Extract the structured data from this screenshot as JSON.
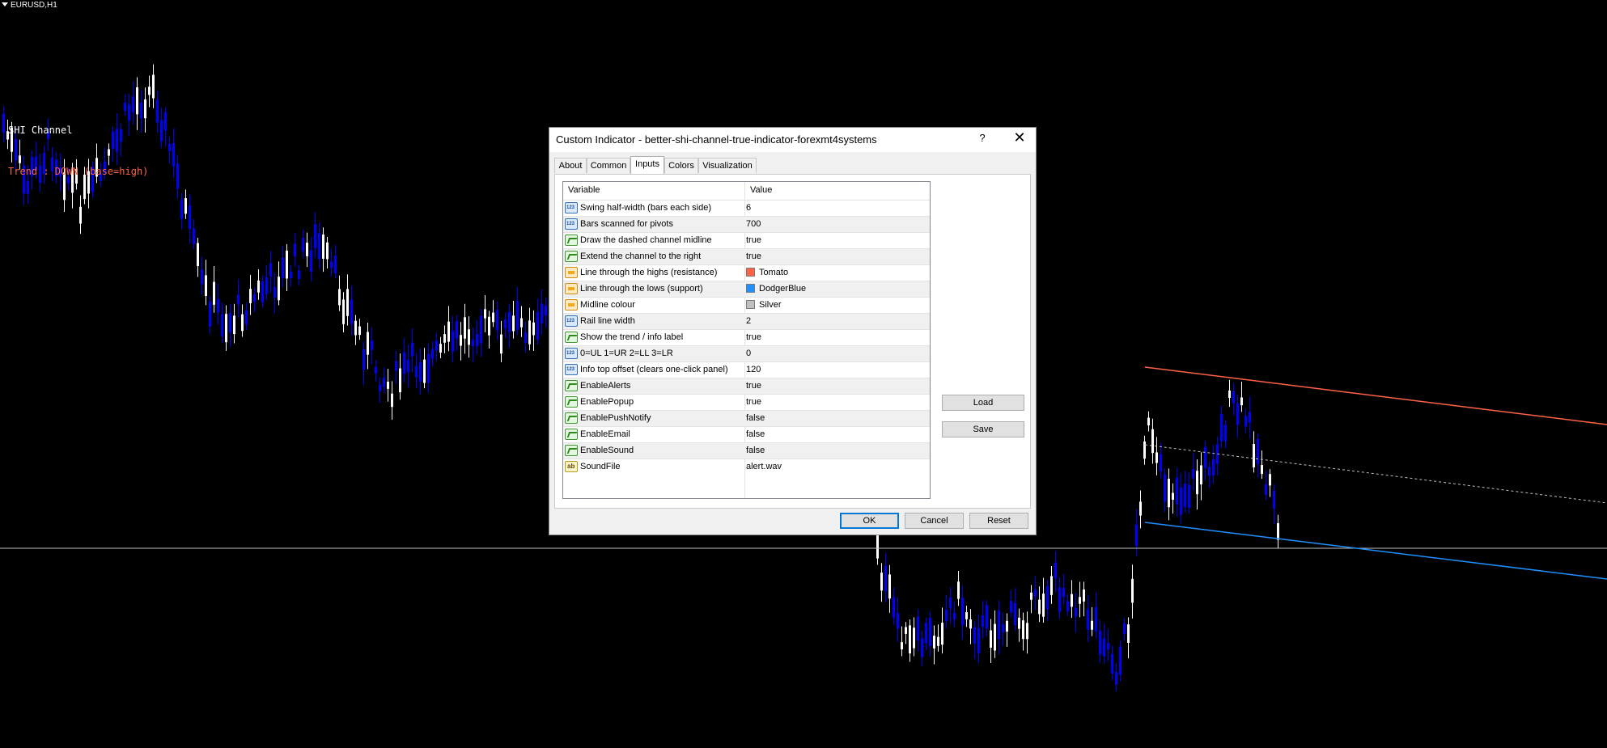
{
  "chart": {
    "symbol": "EURUSD,H1",
    "info_line1": "SHI Channel",
    "info_line2": "Trend : DOWN (base=high)",
    "colors": {
      "background": "#000000",
      "bull_candle": "#ffffff",
      "bear_candle": "#0000ff",
      "resistance": "#ff6347",
      "support": "#1e90ff",
      "midline": "#c0c0c0",
      "grid_line": "#c0c0c0"
    }
  },
  "dialog": {
    "title": "Custom Indicator - better-shi-channel-true-indicator-forexmt4systems",
    "help_label": "?",
    "close_label": "✕",
    "tabs": [
      {
        "label": "About",
        "active": false
      },
      {
        "label": "Common",
        "active": false
      },
      {
        "label": "Inputs",
        "active": true
      },
      {
        "label": "Colors",
        "active": false
      },
      {
        "label": "Visualization",
        "active": false
      }
    ],
    "columns": {
      "variable": "Variable",
      "value": "Value"
    },
    "rows": [
      {
        "type": "int",
        "name": "Swing half-width (bars each side)",
        "value": "6"
      },
      {
        "type": "int",
        "name": "Bars scanned for pivots",
        "value": "700"
      },
      {
        "type": "bool",
        "name": "Draw the dashed channel midline",
        "value": "true"
      },
      {
        "type": "bool",
        "name": "Extend the channel to the right",
        "value": "true"
      },
      {
        "type": "color",
        "name": "Line through the highs (resistance)",
        "value": "Tomato",
        "swatch": "#ff6347"
      },
      {
        "type": "color",
        "name": "Line through the lows (support)",
        "value": "DodgerBlue",
        "swatch": "#1e90ff"
      },
      {
        "type": "color",
        "name": "Midline colour",
        "value": "Silver",
        "swatch": "#c0c0c0"
      },
      {
        "type": "int",
        "name": "Rail line width",
        "value": "2"
      },
      {
        "type": "bool",
        "name": "Show the trend / info label",
        "value": "true"
      },
      {
        "type": "int",
        "name": "0=UL 1=UR 2=LL 3=LR",
        "value": "0"
      },
      {
        "type": "int",
        "name": "Info top offset (clears one-click panel)",
        "value": "120"
      },
      {
        "type": "bool",
        "name": "EnableAlerts",
        "value": "true"
      },
      {
        "type": "bool",
        "name": "EnablePopup",
        "value": "true"
      },
      {
        "type": "bool",
        "name": "EnablePushNotify",
        "value": "false"
      },
      {
        "type": "bool",
        "name": "EnableEmail",
        "value": "false"
      },
      {
        "type": "bool",
        "name": "EnableSound",
        "value": "false"
      },
      {
        "type": "str",
        "name": "SoundFile",
        "value": "alert.wav"
      }
    ],
    "load_label": "Load",
    "save_label": "Save",
    "ok_label": "OK",
    "cancel_label": "Cancel",
    "reset_label": "Reset"
  }
}
